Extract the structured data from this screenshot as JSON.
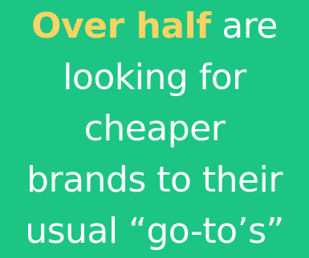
{
  "headline": {
    "highlight": "Over half",
    "line1_rest": " are",
    "line2": "looking for",
    "line3": "cheaper",
    "line4": "brands to their",
    "line5": "usual “go-to’s”"
  },
  "colors": {
    "background": "#1dc584",
    "highlight": "#f7d463",
    "text": "#ffffff"
  }
}
